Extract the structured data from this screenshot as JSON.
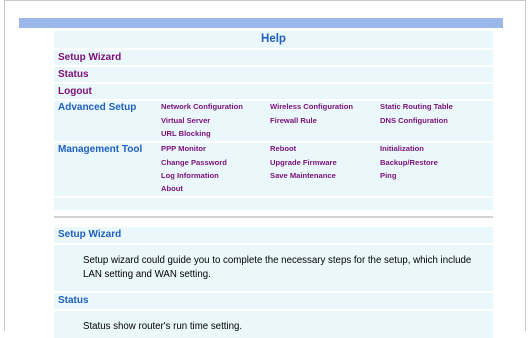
{
  "title": "Help",
  "top_links": [
    "Setup Wizard",
    "Status",
    "Logout"
  ],
  "advanced_setup": {
    "label": "Advanced Setup",
    "row1": [
      "Network Configuration",
      "Wireless Configuration",
      "Static Routing Table"
    ],
    "row2": [
      "Virtual Server",
      "Firewall Rule",
      "DNS Configuration"
    ],
    "row3": [
      "URL Blocking"
    ]
  },
  "management_tool": {
    "label": "Management Tool",
    "row1": [
      "PPP Monitor",
      "Reboot",
      "Initialization"
    ],
    "row2": [
      "Change Password",
      "Upgrade Firmware",
      "Backup/Restore"
    ],
    "row3": [
      "Log Information",
      "Save Maintenance",
      "Ping"
    ],
    "row4": [
      "About"
    ]
  },
  "sections": [
    {
      "heading": "Setup Wizard",
      "body": "Setup wizard could guide you to complete the necessary steps for the setup, which include LAN setting and WAN setting."
    },
    {
      "heading": "Status",
      "body": "Status show router's run time setting."
    }
  ],
  "colors": {
    "banner": "#9cb8ea",
    "panel": "#eaf8fb",
    "link": "#7a0f7a",
    "heading": "#1f5fbf"
  }
}
